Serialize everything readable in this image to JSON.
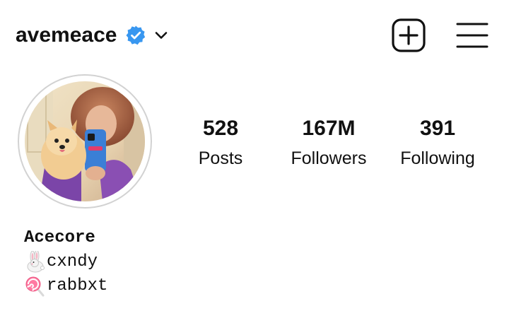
{
  "header": {
    "username": "avemeace",
    "verified_icon": "verified-badge-icon",
    "dropdown_icon": "chevron-down-icon",
    "new_post_icon": "plus-square-icon",
    "menu_icon": "hamburger-menu-icon",
    "verified_color": "#3897f0"
  },
  "stats": {
    "posts": {
      "count": "528",
      "label": "Posts"
    },
    "followers": {
      "count": "167M",
      "label": "Followers"
    },
    "following": {
      "count": "391",
      "label": "Following"
    }
  },
  "bio": {
    "name": "Acecore",
    "lines": [
      {
        "icon": "rabbit-emoji-icon",
        "text": "cxndy"
      },
      {
        "icon": "lollipop-emoji-icon",
        "text": "rabbxt"
      }
    ]
  },
  "avatar": {
    "icon": "profile-photo"
  }
}
